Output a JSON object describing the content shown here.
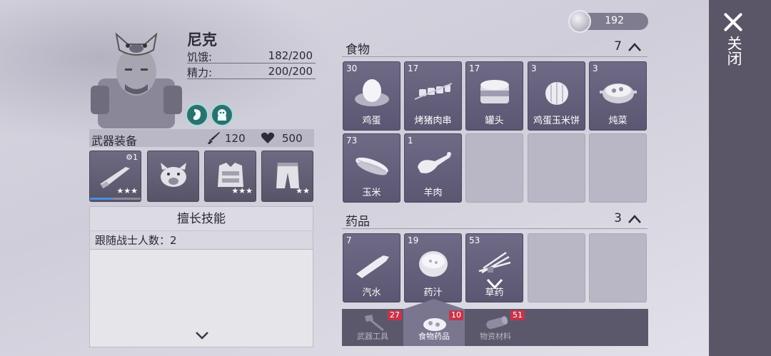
{
  "currency": {
    "icon": "silver-coin-icon",
    "amount": "192"
  },
  "close": {
    "label": "关闭",
    "icon": "close-icon"
  },
  "character": {
    "name": "尼克",
    "stats": [
      {
        "label": "饥饿:",
        "value": "182/200"
      },
      {
        "label": "精力:",
        "value": "200/200"
      }
    ],
    "status_icons": [
      "stomach-status-icon",
      "ghost-status-icon"
    ]
  },
  "equipment": {
    "title": "武器装备",
    "attack": "120",
    "health": "500",
    "slots": [
      {
        "icon": "rifle-icon",
        "stars": "★★★",
        "level": "⚙1",
        "xp_fraction": 0.45
      },
      {
        "icon": "boar-mask-icon",
        "stars": "",
        "level": ""
      },
      {
        "icon": "armor-vest-icon",
        "stars": "★★★",
        "level": ""
      },
      {
        "icon": "pants-icon",
        "stars": "★★",
        "level": ""
      }
    ]
  },
  "skills": {
    "title": "擅长技能",
    "rows": [
      {
        "text": "跟随战士人数：2"
      }
    ]
  },
  "inventory": {
    "food": {
      "title": "食物",
      "count": "7",
      "items": [
        {
          "qty": "30",
          "name": "鸡蛋",
          "icon": "egg-nest-icon"
        },
        {
          "qty": "17",
          "name": "烤猪肉串",
          "icon": "skewer-icon"
        },
        {
          "qty": "17",
          "name": "罐头",
          "icon": "can-icon"
        },
        {
          "qty": "3",
          "name": "鸡蛋玉米饼",
          "icon": "pancake-icon"
        },
        {
          "qty": "3",
          "name": "炖菜",
          "icon": "stew-pot-icon"
        },
        {
          "qty": "73",
          "name": "玉米",
          "icon": "corn-icon"
        },
        {
          "qty": "1",
          "name": "羊肉",
          "icon": "lamb-leg-icon"
        }
      ]
    },
    "medicine": {
      "title": "药品",
      "count": "3",
      "items": [
        {
          "qty": "7",
          "name": "汽水",
          "icon": "soda-bottle-icon"
        },
        {
          "qty": "19",
          "name": "药汁",
          "icon": "medicine-bowl-icon"
        },
        {
          "qty": "53",
          "name": "草药",
          "icon": "herb-icon"
        }
      ]
    }
  },
  "tabs": [
    {
      "label": "武器工具",
      "badge": "27",
      "icon": "axe-icon"
    },
    {
      "label": "食物药品",
      "badge": "10",
      "icon": "food-icon"
    },
    {
      "label": "物资材料",
      "badge": "51",
      "icon": "log-icon"
    }
  ]
}
